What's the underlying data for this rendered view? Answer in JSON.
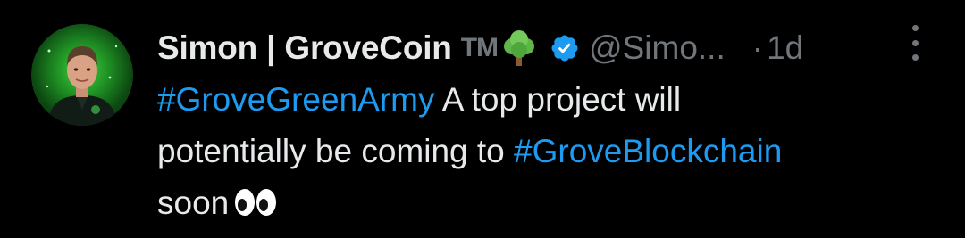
{
  "author": {
    "display_name": "Simon | GroveCoin",
    "tm": "TM",
    "handle": "@Simo...",
    "dot": "·",
    "time": "1d"
  },
  "tweet": {
    "hashtag1": "#GroveGreenArmy",
    "text1": " A top project will",
    "text2": "potentially be coming to ",
    "hashtag2": "#GroveBlockchain",
    "text3": "soon"
  },
  "icons": {
    "tree": "tree-emoji-icon",
    "verified": "verified-badge-icon",
    "eyes": "eyes-emoji-icon",
    "more": "more-options-icon"
  },
  "colors": {
    "background": "#000000",
    "text": "#e7e9ea",
    "muted": "#71767b",
    "link": "#1d9bf0",
    "verified": "#1d9bf0"
  }
}
